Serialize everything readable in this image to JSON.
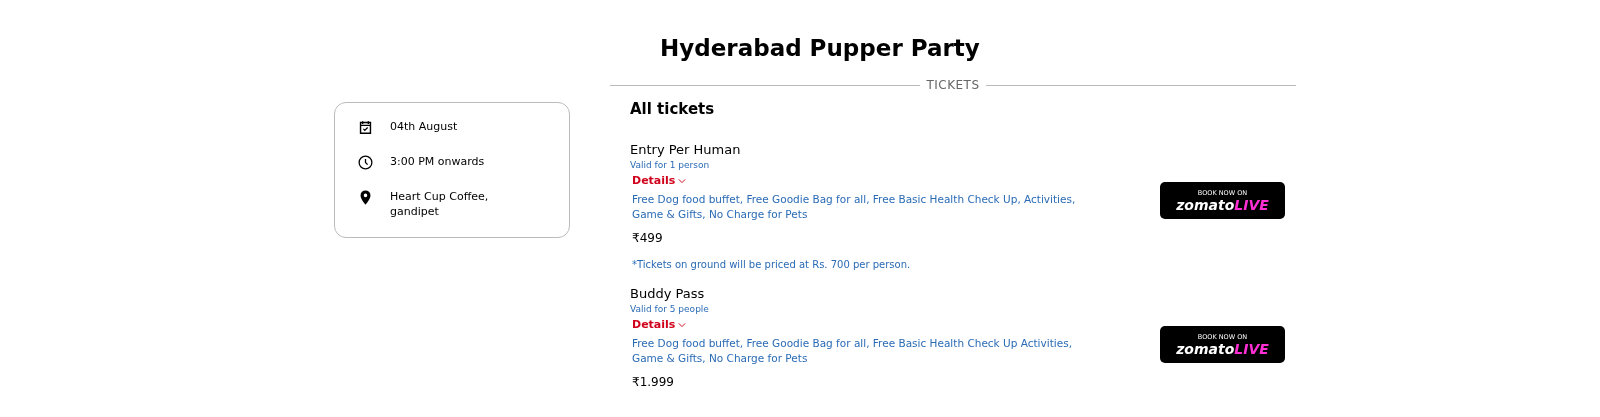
{
  "title": "Hyderabad Pupper Party",
  "info": [
    {
      "kind": "date",
      "text": "04th August"
    },
    {
      "kind": "time",
      "text": "3:00 PM onwards"
    },
    {
      "kind": "location",
      "text": "Heart Cup Coffee,\ngandipet"
    }
  ],
  "section_label": "TICKETS",
  "tickets_heading": "All tickets",
  "tickets": [
    {
      "name": "Entry Per Human",
      "validity": "Valid for 1 person",
      "details_label": "Details",
      "expanded": true,
      "description": "Free Dog food buffet, Free Goodie Bag for all, Free Basic Health Check Up, Activities, Game & Gifts, No Charge for Pets",
      "price": "₹499",
      "note": "*Tickets on ground will be priced at Rs. 700 per person.",
      "button": {
        "top": "BOOK NOW ON",
        "brand": "zomato",
        "brand_accent": "LIVE"
      }
    },
    {
      "name": "Buddy Pass",
      "validity": "Valid for 5 people",
      "details_label": "Details",
      "expanded": true,
      "description": "Free Dog food buffet, Free Goodie Bag for all, Free Basic Health Check Up Activities, Game & Gifts, No Charge for Pets",
      "price": "₹1.999",
      "button": {
        "top": "BOOK NOW ON",
        "brand": "zomato",
        "brand_accent": "LIVE"
      }
    }
  ]
}
